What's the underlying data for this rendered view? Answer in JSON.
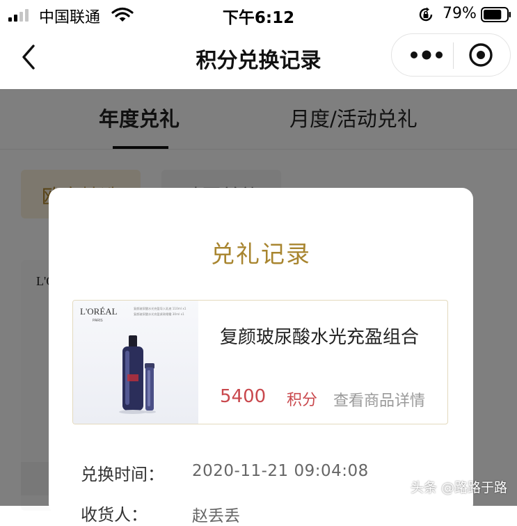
{
  "status_bar": {
    "carrier": "中国联通",
    "time": "下午6:12",
    "battery_percent": "79%",
    "battery_level": 0.79
  },
  "nav": {
    "title": "积分兑换记录"
  },
  "tabs": [
    {
      "label": "年度兑礼",
      "active": true
    },
    {
      "label": "月度/活动兑礼",
      "active": false
    }
  ],
  "filters": [
    {
      "label": "欧宝精选"
    },
    {
      "label": "臻囤兑礼"
    }
  ],
  "background_card": {
    "brand": "L'O"
  },
  "modal": {
    "title": "兑礼记录",
    "product": {
      "image_brand": "L'ORÉAL",
      "image_brand_sub": "PARIS",
      "image_caption_1": "复颜玻尿酸水光充盈导入乳液 110ml x1",
      "image_caption_2": "复颜玻尿酸水光充盈紧致眼霜 30ml x1",
      "name": "复颜玻尿酸水光充盈组合",
      "points": "5400",
      "points_unit": "积分",
      "details_link": "查看商品详情"
    },
    "exchange_time_label": "兑换时间：",
    "exchange_time_value": "2020-11-21 09:04:08",
    "recipient_label": "收货人：",
    "recipient_value": "赵丢丢"
  },
  "watermark": "头条 @路路于路",
  "colors": {
    "accent_gold": "#a8852f",
    "points_red": "#c9484d",
    "overlay": "rgba(0,0,0,0.5)"
  }
}
